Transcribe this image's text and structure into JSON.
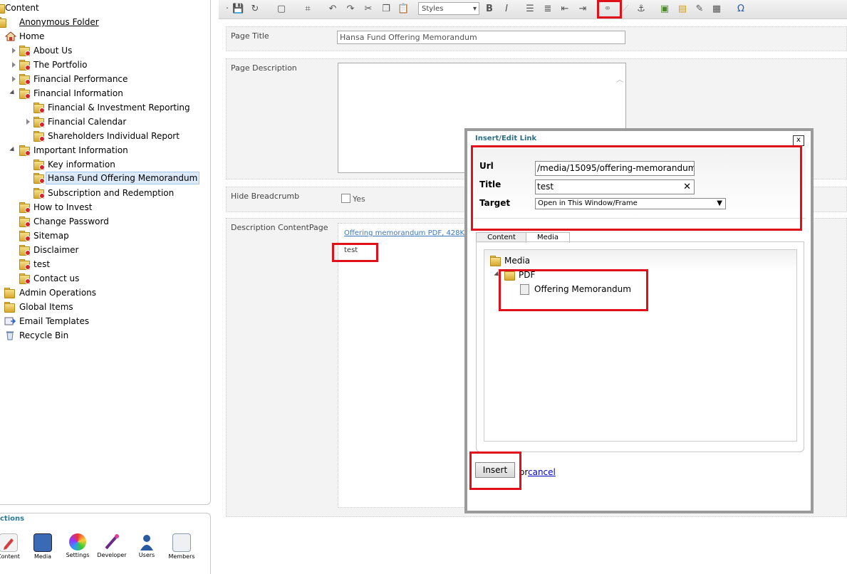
{
  "tree": {
    "items": [
      {
        "label": "Content"
      },
      {
        "label": "Anonymous Folder"
      },
      {
        "label": "Home"
      },
      {
        "label": "About Us"
      },
      {
        "label": "The Portfolio"
      },
      {
        "label": "Financial Performance"
      },
      {
        "label": "Financial Information"
      },
      {
        "label": "Financial & Investment Reporting"
      },
      {
        "label": "Financial Calendar"
      },
      {
        "label": "Shareholders Individual Report"
      },
      {
        "label": "Important Information"
      },
      {
        "label": "Key information"
      },
      {
        "label": "Hansa Fund Offering Memorandum"
      },
      {
        "label": "Subscription and Redemption"
      },
      {
        "label": "How to Invest"
      },
      {
        "label": "Change Password"
      },
      {
        "label": "Sitemap"
      },
      {
        "label": "Disclaimer"
      },
      {
        "label": "test"
      },
      {
        "label": "Contact us"
      },
      {
        "label": "Admin Operations"
      },
      {
        "label": "Global Items"
      },
      {
        "label": "Email Templates"
      },
      {
        "label": "Recycle Bin"
      }
    ]
  },
  "sections": {
    "title": "ctions",
    "items": [
      {
        "label": "Content",
        "color": "#c44"
      },
      {
        "label": "Media",
        "color": "#3a6ab5"
      },
      {
        "label": "Settings",
        "color": "#e8a020"
      },
      {
        "label": "Developer",
        "color": "#7a3a9a"
      },
      {
        "label": "Users",
        "color": "#2a5aa0"
      },
      {
        "label": "Members",
        "color": "#6a7a90"
      }
    ]
  },
  "toolbar": {
    "styles_label": "Styles"
  },
  "form": {
    "page_title_label": "Page Title",
    "page_title_value": "Hansa Fund Offering Memorandum",
    "page_description_label": "Page Description",
    "hide_breadcrumb_label": "Hide Breadcrumb",
    "hide_breadcrumb_option": "Yes",
    "description_content_label": "Description ContentPage",
    "pdf_link_text": "Offering memorandum PDF, 428K",
    "test_text": "test"
  },
  "dialog": {
    "title": "Insert/Edit Link",
    "close": "x",
    "url_label": "Url",
    "url_value": "/media/15095/offering-memorandum.",
    "title_label": "Title",
    "title_value": "test",
    "target_label": "Target",
    "target_value": "Open in This Window/Frame",
    "tabs": [
      "Content",
      "Media"
    ],
    "media_root": "Media",
    "media_folder": "PDF",
    "media_file": "Offering Memorandum",
    "insert_label": "Insert",
    "or_text": "or",
    "cancel_label": "cancel"
  },
  "colors": {
    "highlight": "#e0101a",
    "dialog_border": "#9b9b9b",
    "link": "#3a78c2"
  }
}
